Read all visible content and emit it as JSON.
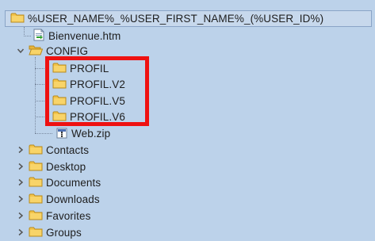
{
  "tree": {
    "root": {
      "label": "%USER_NAME%_%USER_FIRST_NAME%_(%USER_ID%)",
      "icon": "folder-icon"
    },
    "items": [
      {
        "label": "Bienvenue.htm",
        "icon": "html-file-icon"
      },
      {
        "label": "CONFIG",
        "icon": "folder-open-icon",
        "expanded": true,
        "children": [
          {
            "label": "PROFIL",
            "icon": "folder-icon"
          },
          {
            "label": "PROFIL.V2",
            "icon": "folder-icon"
          },
          {
            "label": "PROFIL.V5",
            "icon": "folder-icon"
          },
          {
            "label": "PROFIL.V6",
            "icon": "folder-icon"
          },
          {
            "label": "Web.zip",
            "icon": "zip-file-icon"
          }
        ]
      },
      {
        "label": "Contacts",
        "icon": "folder-icon",
        "expanded": false
      },
      {
        "label": "Desktop",
        "icon": "folder-icon",
        "expanded": false
      },
      {
        "label": "Documents",
        "icon": "folder-icon",
        "expanded": false
      },
      {
        "label": "Downloads",
        "icon": "folder-icon",
        "expanded": false
      },
      {
        "label": "Favorites",
        "icon": "folder-icon",
        "expanded": false
      },
      {
        "label": "Groups",
        "icon": "folder-icon",
        "expanded": false
      }
    ]
  },
  "colors": {
    "panel_background": "#bcd2ea",
    "highlight_border": "#ee1111",
    "folder_fill": "#f3c44a"
  }
}
